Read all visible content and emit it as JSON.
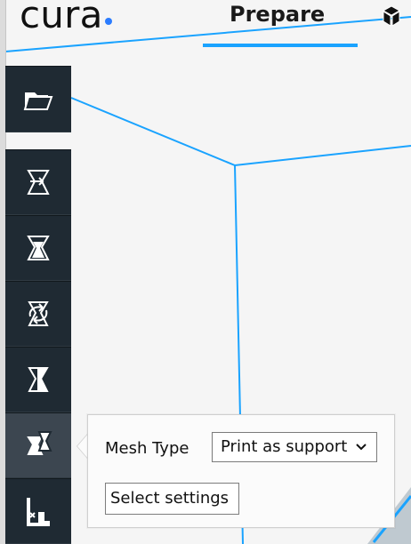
{
  "header": {
    "logo_text": "cura",
    "tabs": [
      {
        "label": "Prepare"
      }
    ]
  },
  "toolbar": {
    "items": [
      {
        "icon": "folder-open-icon"
      },
      {
        "icon": "move-icon"
      },
      {
        "icon": "scale-icon"
      },
      {
        "icon": "rotate-icon"
      },
      {
        "icon": "mirror-icon"
      },
      {
        "icon": "per-model-settings-icon"
      },
      {
        "icon": "support-blocker-icon"
      }
    ]
  },
  "mesh_type_popup": {
    "label": "Mesh Type",
    "selected": "Print as support",
    "button_label": "Select settings"
  },
  "colors": {
    "accent": "#1aa3ff",
    "toolbar": "#1f2a33",
    "toolbar_active": "#3c4650",
    "background": "#f5f5f5"
  }
}
